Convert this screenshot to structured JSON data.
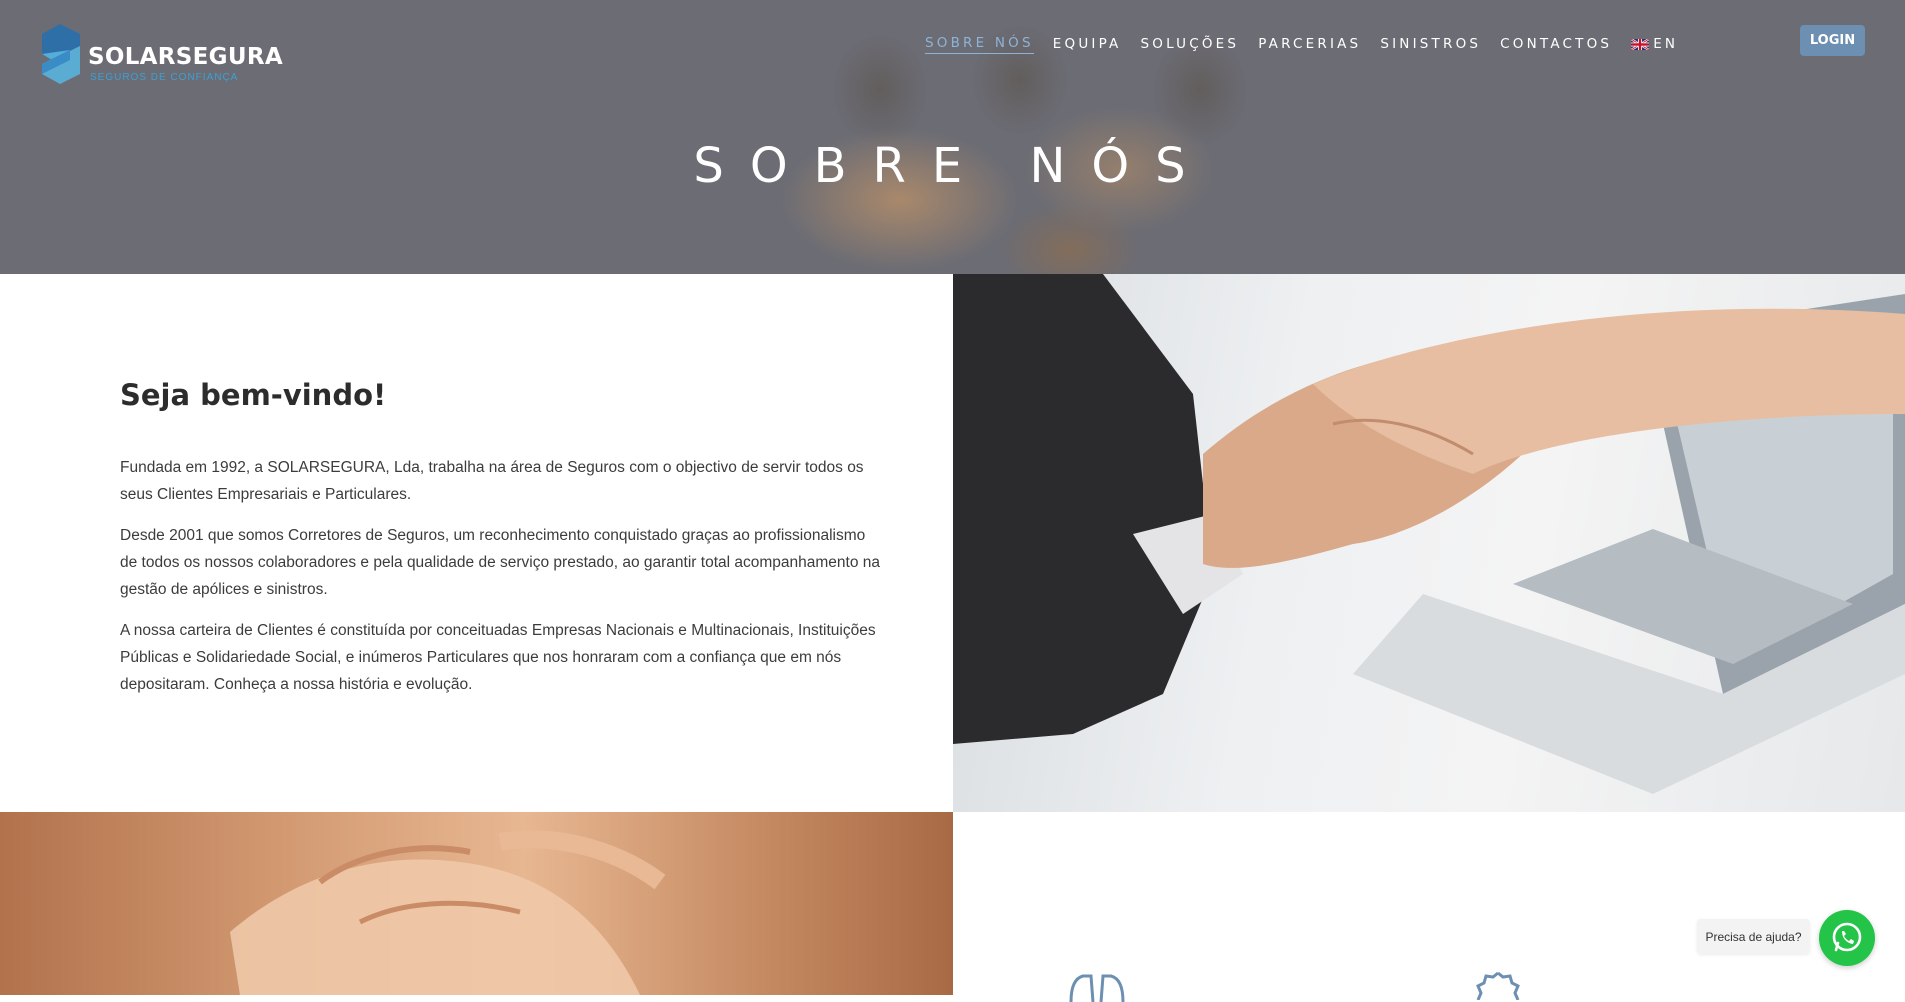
{
  "header": {
    "logo": {
      "name": "SOLARSEGURA",
      "tagline": "SEGUROS DE CONFIANÇA"
    },
    "nav": [
      {
        "label": "SOBRE NÓS",
        "active": true
      },
      {
        "label": "EQUIPA"
      },
      {
        "label": "SOLUÇÕES"
      },
      {
        "label": "PARCERIAS"
      },
      {
        "label": "SINISTROS"
      },
      {
        "label": "CONTACTOS"
      }
    ],
    "language": {
      "label": "EN",
      "flag_icon": "uk-flag-icon"
    },
    "login_label": "LOGIN"
  },
  "hero": {
    "title": "SOBRE NÓS"
  },
  "welcome": {
    "heading": "Seja bem-vindo!",
    "paragraphs": [
      "Fundada em 1992, a SOLARSEGURA, Lda, trabalha na área de Seguros com o objectivo de servir todos os seus Clientes Empresariais e Particulares.",
      "Desde 2001 que somos Corretores de Seguros, um reconhecimento conquistado graças ao profissionalismo de todos os nossos colaboradores e pela qualidade de serviço prestado, ao garantir total acompanhamento na gestão de apólices e sinistros.",
      "A nossa carteira de Clientes é constituída por conceituadas Empresas Nacionais e Multinacionais, Instituições Públicas e Solidariedade Social, e inúmeros Particulares que nos honraram com a confiança que em nós depositaram. Conheça a nossa história e evolução."
    ]
  },
  "chat": {
    "help_label": "Precisa de ajuda?",
    "icon": "whatsapp-icon"
  },
  "colors": {
    "accent": "#6d8fb2",
    "nav_active": "#8fb3d6",
    "brand_blue": "#3e9fd6",
    "whatsapp": "#23c447",
    "icon_blue": "#6d8fb2"
  }
}
